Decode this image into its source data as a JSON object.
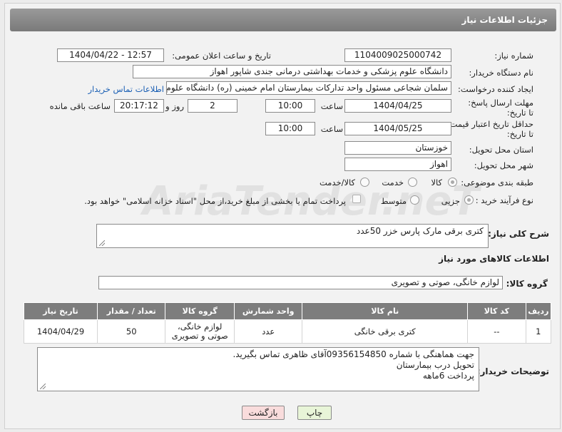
{
  "header": {
    "title": "جزئیات اطلاعات نیاز"
  },
  "form": {
    "need_number": {
      "label": "شماره نیاز:",
      "value": "1104009025000742"
    },
    "announce": {
      "label": "تاریخ و ساعت اعلان عمومی:",
      "value": "1404/04/22 - 12:57"
    },
    "buyer_org": {
      "label": "نام دستگاه خریدار:",
      "value": "دانشگاه علوم پزشکی و خدمات بهداشتی درمانی جندی شاپور اهواز"
    },
    "requester": {
      "label": "ایجاد کننده درخواست:",
      "value": "سلمان شجاعی مسئول واحد تدارکات بیمارستان امام خمینی (ره) دانشگاه علوم پزشکی",
      "contact_link": "اطلاعات تماس خریدار"
    },
    "reply_deadline": {
      "label": "مهلت ارسال پاسخ: تا تاریخ:",
      "date": "1404/04/25",
      "time_label": "ساعت",
      "time": "10:00",
      "days": "2",
      "days_label": "روز و",
      "remaining": "20:17:12",
      "remaining_label": "ساعت باقی مانده"
    },
    "price_validity": {
      "label": "حداقل تاریخ اعتبار قیمت: تا تاریخ:",
      "date": "1404/05/25",
      "time_label": "ساعت",
      "time": "10:00"
    },
    "province": {
      "label": "استان محل تحویل:",
      "value": "خوزستان"
    },
    "city": {
      "label": "شهر محل تحویل:",
      "value": "اهواز"
    },
    "category": {
      "label": "طبقه بندی موضوعی:",
      "options": [
        "کالا",
        "خدمت",
        "کالا/خدمت"
      ]
    },
    "process": {
      "label": "نوع فرآیند خرید :",
      "options": [
        "جزیی",
        "متوسط"
      ],
      "note": "پرداخت تمام یا بخشی از مبلغ خرید،از محل \"اسناد خزانه اسلامی\" خواهد بود."
    }
  },
  "description": {
    "label": "شرح کلی نیاز:",
    "value": "کتری برقی مارک پارس خزر 50عدد"
  },
  "goods_section": {
    "title": "اطلاعات کالاهای مورد نیاز",
    "group_label": "گروه کالا:",
    "group_value": "لوازم خانگی، صوتی و تصویری"
  },
  "table": {
    "headers": [
      "ردیف",
      "کد کالا",
      "نام کالا",
      "واحد شمارش",
      "گروه کالا",
      "تعداد / مقدار",
      "تاریخ نیاز"
    ],
    "rows": [
      {
        "row": "1",
        "code": "--",
        "name": "کتری برقی خانگی",
        "unit": "عدد",
        "group_line1": "لوازم خانگی،",
        "group_line2": "صوتی و تصویری",
        "qty": "50",
        "date": "1404/04/29"
      }
    ]
  },
  "buyer_notes": {
    "label": "توضیحات خریدار:",
    "lines": [
      "جهت هماهنگی با شماره 09356154850آقای ظاهری تماس بگیرید.",
      "تحویل درب بیمارستان",
      "پرداخت 6ماهه"
    ]
  },
  "buttons": {
    "print": "چاپ",
    "back": "بازگشت"
  },
  "watermark": "AriaTender.neT"
}
